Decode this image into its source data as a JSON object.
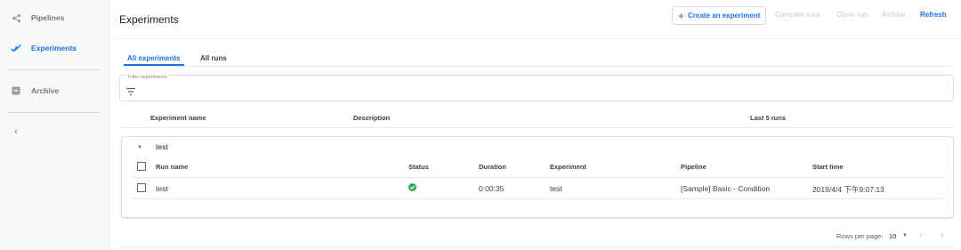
{
  "sidebar": {
    "items": [
      {
        "label": "Pipelines",
        "icon": "pipelines-icon",
        "active": false
      },
      {
        "label": "Experiments",
        "icon": "experiments-check-icon",
        "active": true
      },
      {
        "label": "Archive",
        "icon": "archive-icon",
        "active": false
      }
    ],
    "collapse_glyph": "‹"
  },
  "header": {
    "title": "Experiments",
    "create_label": "Create an experiment",
    "compare_label": "Compare runs",
    "clone_label": "Clone run",
    "archive_label": "Archive",
    "refresh_label": "Refresh"
  },
  "tabs": [
    {
      "label": "All experiments",
      "active": true
    },
    {
      "label": "All runs",
      "active": false
    }
  ],
  "filter": {
    "label": "Filter experiments",
    "value": ""
  },
  "experiments_table": {
    "columns": [
      "Experiment name",
      "Description",
      "Last 5 runs"
    ]
  },
  "group": {
    "name": "test",
    "runs_table": {
      "columns": [
        "Run name",
        "Status",
        "Duration",
        "Experiment",
        "Pipeline",
        "Start time"
      ],
      "rows": [
        {
          "run_name": "test",
          "status": "success",
          "duration": "0:00:35",
          "experiment": "test",
          "pipeline": "[Sample] Basic - Condition",
          "start_time": "2019/4/4 下午9:07:13"
        }
      ]
    }
  },
  "pagination": {
    "rows_per_page_label": "Rows per page:",
    "rows_per_page": "10"
  },
  "colors": {
    "accent": "#1a73e8",
    "success": "#34a853",
    "disabled": "#c5c8cc"
  }
}
